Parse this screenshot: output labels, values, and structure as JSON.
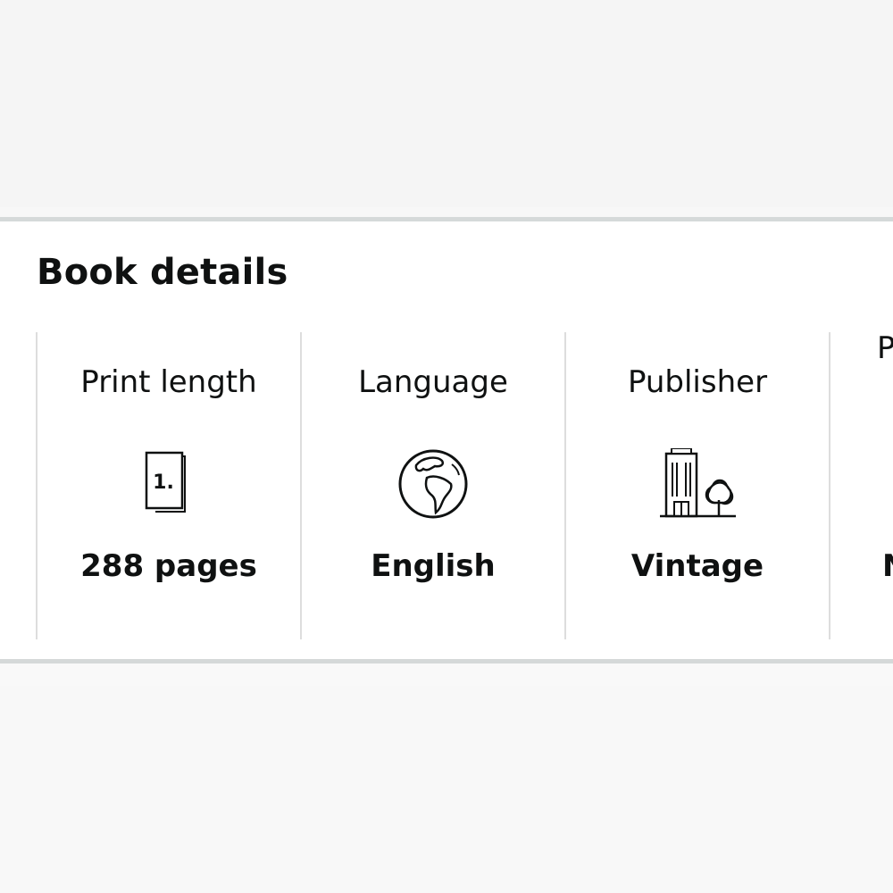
{
  "section": {
    "title": "Book details"
  },
  "details": [
    {
      "label": "Print length",
      "icon": "page-count-icon",
      "value": "288 pages"
    },
    {
      "label": "Language",
      "icon": "globe-icon",
      "value": "English"
    },
    {
      "label": "Publisher",
      "icon": "publisher-building-icon",
      "value": "Vintage"
    },
    {
      "label": "P",
      "icon": "",
      "value": "N"
    }
  ],
  "colors": {
    "divider": "#d5d9d9",
    "text": "#0f1111"
  }
}
